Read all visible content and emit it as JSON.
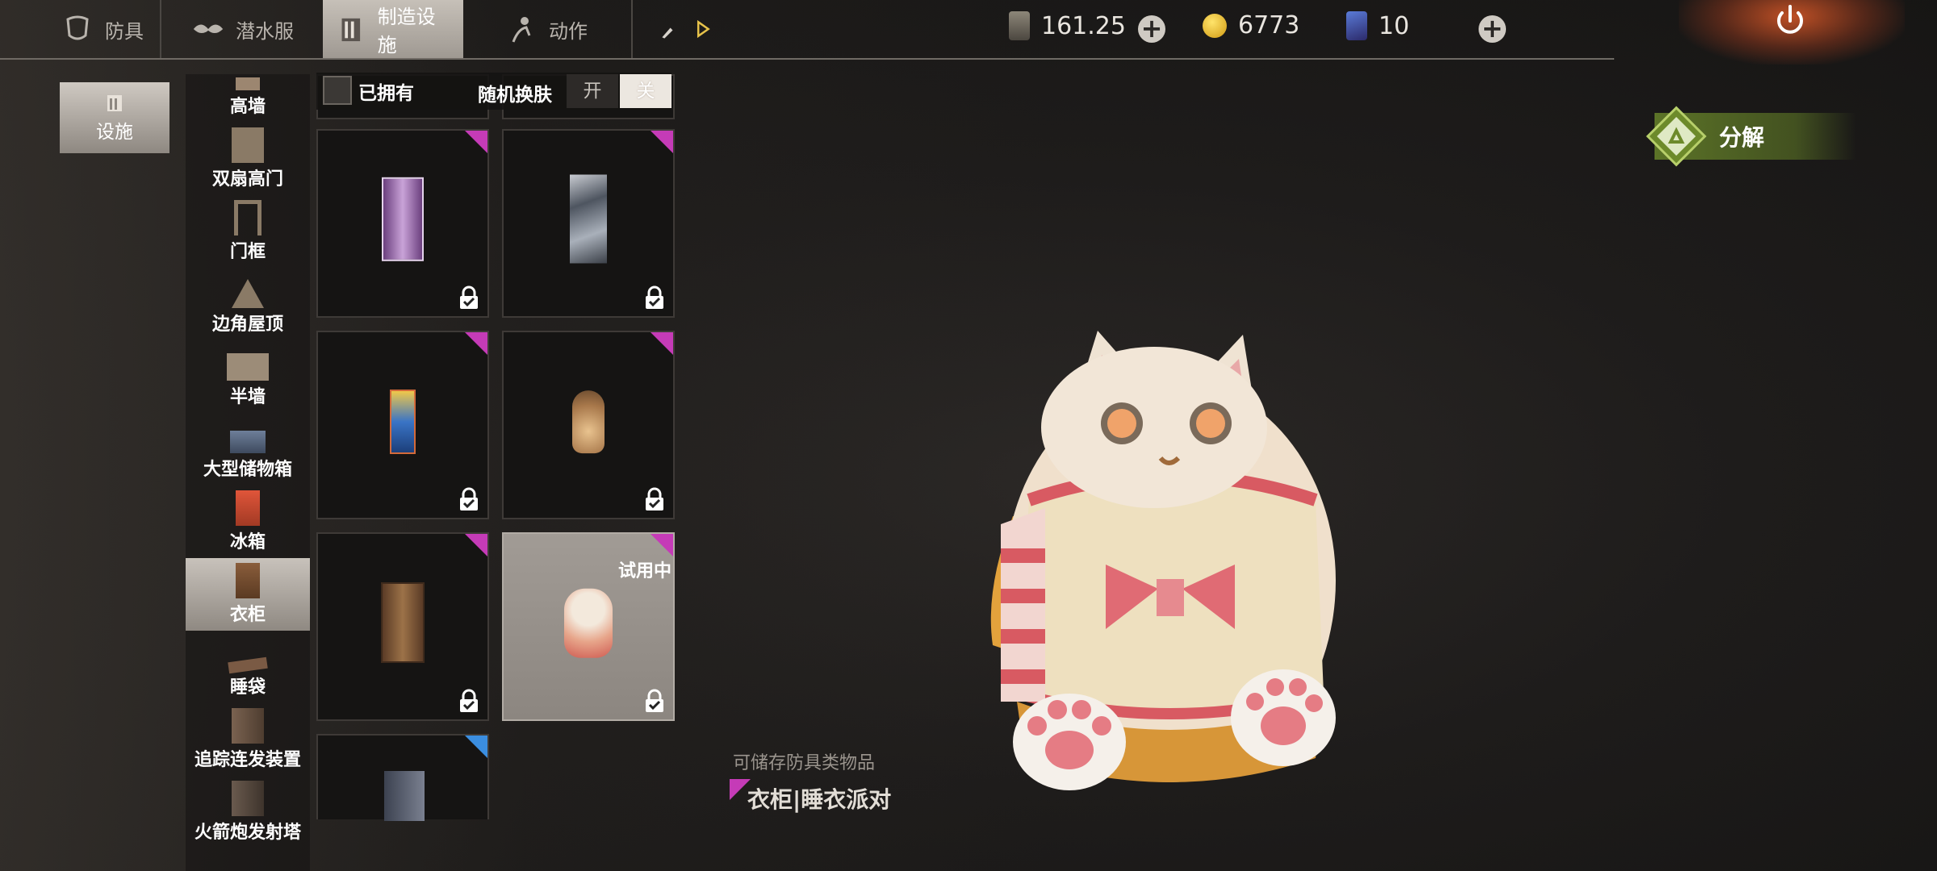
{
  "tabs": [
    {
      "label": "防具",
      "icon": "armor-icon"
    },
    {
      "label": "潜水服",
      "icon": "diving-suit-icon"
    },
    {
      "label": "制造设施",
      "icon": "facility-icon",
      "active": true
    },
    {
      "label": "动作",
      "icon": "action-icon"
    },
    {
      "label": "",
      "icon": "paint-brush-icon"
    }
  ],
  "currencies": [
    {
      "icon": "card-currency-icon",
      "value": "161.25"
    },
    {
      "icon": "gold-coin-icon",
      "value": "6773"
    },
    {
      "icon": "ticket-icon",
      "value": "10"
    }
  ],
  "category": {
    "label": "设施",
    "icon": "facility-icon"
  },
  "subcategories": [
    {
      "label": "高墙"
    },
    {
      "label": "双扇高门"
    },
    {
      "label": "门框"
    },
    {
      "label": "边角屋顶"
    },
    {
      "label": "半墙"
    },
    {
      "label": "大型储物箱"
    },
    {
      "label": "冰箱"
    },
    {
      "label": "衣柜",
      "active": true
    },
    {
      "label": "睡袋"
    },
    {
      "label": "追踪连发装置"
    },
    {
      "label": "火箭炮发射塔"
    }
  ],
  "filter": {
    "owned_label": "已拥有",
    "random_label": "随机换肤",
    "on_label": "开",
    "off_label": "关"
  },
  "grid": {
    "trial_label": "试用中"
  },
  "description": {
    "subtitle": "可储存防具类物品",
    "title": "衣柜|睡衣派对"
  },
  "decompose": {
    "label": "分解",
    "icon": "recycle-icon"
  },
  "colors": {
    "rarity_purple": "#c53bb7",
    "rarity_blue": "#3b8ee0",
    "decompose_green": "#5f7828"
  }
}
